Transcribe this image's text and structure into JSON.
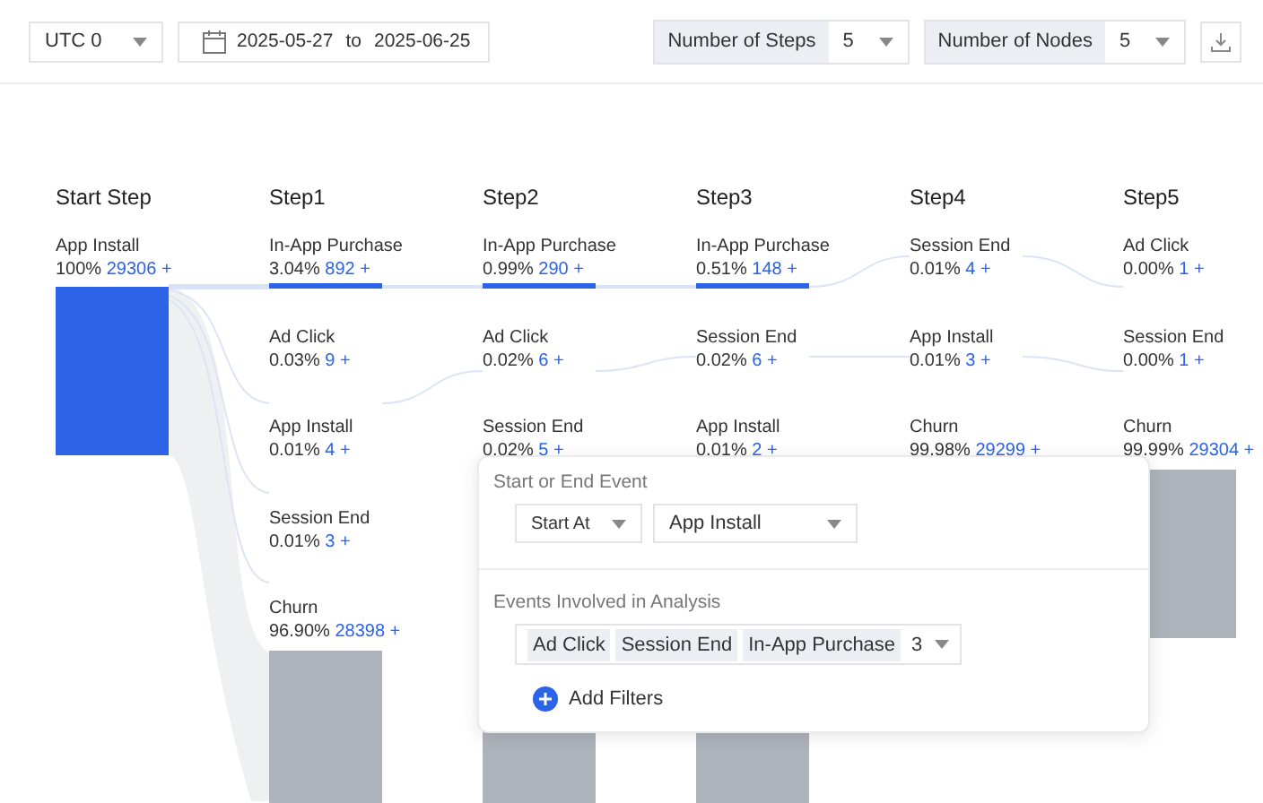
{
  "toolbar": {
    "timezone": "UTC 0",
    "date_from": "2025-05-27",
    "date_sep": "to",
    "date_to": "2025-06-25",
    "steps": {
      "label": "Number of Steps",
      "value": "5"
    },
    "nodes": {
      "label": "Number of Nodes",
      "value": "5"
    }
  },
  "columns": [
    {
      "title": "Start Step",
      "nodes": [
        {
          "kind": "start",
          "name": "App Install",
          "percent": "100%",
          "count": "29306 +"
        }
      ]
    },
    {
      "title": "Step1",
      "nodes": [
        {
          "kind": "main",
          "name": "In-App Purchase",
          "percent": "3.04%",
          "count": "892 +"
        },
        {
          "kind": "minor",
          "name": "Ad Click",
          "percent": "0.03%",
          "count": "9 +"
        },
        {
          "kind": "minor",
          "name": "App Install",
          "percent": "0.01%",
          "count": "4 +"
        },
        {
          "kind": "minor",
          "name": "Session End",
          "percent": "0.01%",
          "count": "3 +"
        },
        {
          "kind": "churn",
          "name": "Churn",
          "percent": "96.90%",
          "count": "28398 +"
        }
      ]
    },
    {
      "title": "Step2",
      "nodes": [
        {
          "kind": "main",
          "name": "In-App Purchase",
          "percent": "0.99%",
          "count": "290 +"
        },
        {
          "kind": "minor",
          "name": "Ad Click",
          "percent": "0.02%",
          "count": "6 +"
        },
        {
          "kind": "minor",
          "name": "Session End",
          "percent": "0.02%",
          "count": "5 +"
        },
        {
          "kind": "churn"
        }
      ]
    },
    {
      "title": "Step3",
      "nodes": [
        {
          "kind": "main",
          "name": "In-App Purchase",
          "percent": "0.51%",
          "count": "148 +"
        },
        {
          "kind": "minor",
          "name": "Session End",
          "percent": "0.02%",
          "count": "6 +"
        },
        {
          "kind": "minor",
          "name": "App Install",
          "percent": "0.01%",
          "count": "2 +"
        },
        {
          "kind": "churn"
        }
      ]
    },
    {
      "title": "Step4",
      "nodes": [
        {
          "kind": "minor",
          "name": "Session End",
          "percent": "0.01%",
          "count": "4 +"
        },
        {
          "kind": "minor",
          "name": "App Install",
          "percent": "0.01%",
          "count": "3 +"
        },
        {
          "kind": "covered",
          "name": "Churn",
          "percent": "99.98%",
          "count": "29299 +"
        }
      ]
    },
    {
      "title": "Step5",
      "nodes": [
        {
          "kind": "minor",
          "name": "Ad Click",
          "percent": "0.00%",
          "count": "1 +"
        },
        {
          "kind": "minor",
          "name": "Session End",
          "percent": "0.00%",
          "count": "1 +"
        },
        {
          "kind": "churn",
          "name": "Churn",
          "percent": "99.99%",
          "count": "29304 +"
        }
      ]
    }
  ],
  "popup": {
    "section_1": "Start or End Event",
    "mode": "Start At",
    "event": "App Install",
    "section_2": "Events Involved in Analysis",
    "tags": [
      "Ad Click",
      "Session End",
      "In-App Purchase"
    ],
    "tag_count": "3",
    "add": "Add Filters"
  }
}
